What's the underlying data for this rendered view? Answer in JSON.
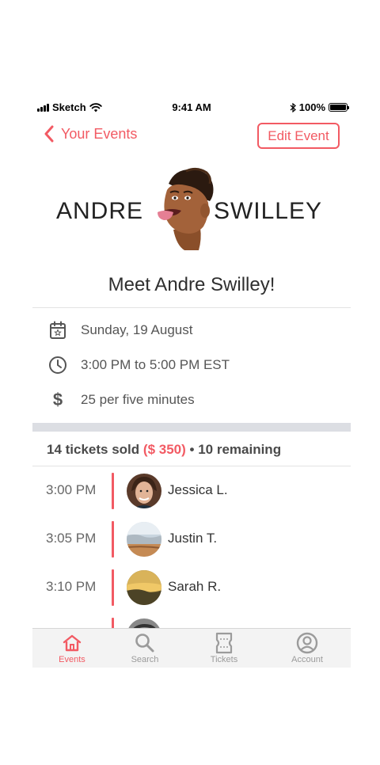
{
  "status_bar": {
    "carrier": "Sketch",
    "time": "9:41 AM",
    "battery": "100%",
    "battery_level": 1.0
  },
  "nav": {
    "back_label": "Your Events",
    "edit_label": "Edit Event"
  },
  "hero": {
    "first_name": "ANDRE",
    "last_name": "SWILLEY"
  },
  "event": {
    "title": "Meet Andre Swilley!",
    "date": "Sunday, 19 August",
    "time_range": "3:00 PM to 5:00 PM EST",
    "price": "25 per five minutes"
  },
  "summary": {
    "sold": "14 tickets sold",
    "amount": "($ 350)",
    "separator": "•",
    "remaining": "10 remaining"
  },
  "attendees": [
    {
      "time": "3:00 PM",
      "name": "Jessica L."
    },
    {
      "time": "3:05 PM",
      "name": "Justin T."
    },
    {
      "time": "3:10 PM",
      "name": "Sarah R."
    }
  ],
  "tabs": [
    {
      "label": "Events",
      "icon": "home-icon",
      "active": true
    },
    {
      "label": "Search",
      "icon": "search-icon",
      "active": false
    },
    {
      "label": "Tickets",
      "icon": "ticket-icon",
      "active": false
    },
    {
      "label": "Account",
      "icon": "account-icon",
      "active": false
    }
  ],
  "colors": {
    "accent": "#f25a63",
    "separator": "#dcdee3",
    "tabbar": "#f3f3f3"
  }
}
